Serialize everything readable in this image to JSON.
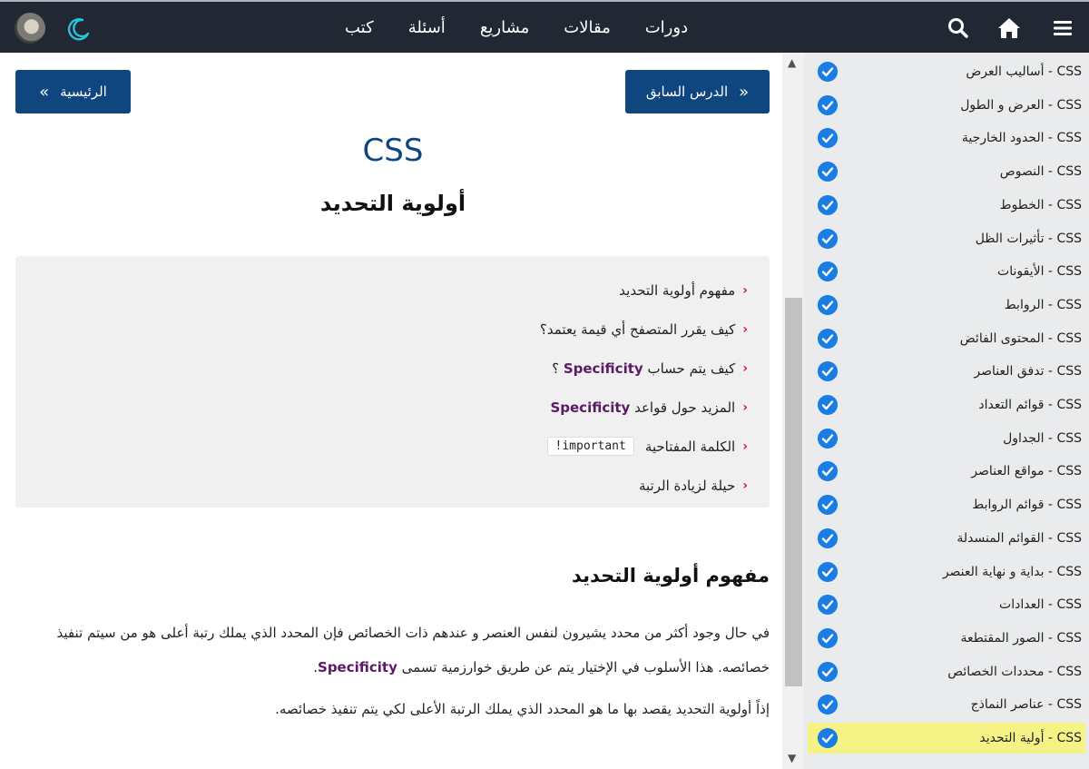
{
  "topbar": {
    "nav": [
      "دورات",
      "مقالات",
      "مشاريع",
      "أسئلة",
      "كتب"
    ]
  },
  "buttons": {
    "previous": "الدرس السابق",
    "home": "الرئيسية",
    "prev_chevron": "«",
    "home_chevron": "»"
  },
  "page": {
    "title": "CSS",
    "lesson_title": "أولوية التحديد"
  },
  "toc": [
    {
      "text": "مفهوم أولوية التحديد"
    },
    {
      "text": "كيف يقرر المتصفح أي قيمة يعتمد؟"
    },
    {
      "text": "كيف يتم حساب",
      "keyword": "Specificity",
      "after": " ؟"
    },
    {
      "text": "المزيد حول قواعد",
      "keyword": "Specificity"
    },
    {
      "text": "الكلمة المفتاحية",
      "code": "!important"
    },
    {
      "text": "حيلة لزيادة الرتبة"
    }
  ],
  "toc_arrow": "‹",
  "section": {
    "heading": "مفهوم أولوية التحديد",
    "p1": "في حال وجود أكثر من محدد يشيرون لنفس العنصر و عندهم ذات الخصائص فإن المحدد الذي يملك رتبة أعلى هو من سيتم تنفيذ",
    "p1b": "خصائصه. هذا الأسلوب في الإختيار يتم عن طريق خوارزمية تسمى",
    "p1_keyword": "Specificity",
    "p1_end": ".",
    "p2": "إذاً أولوية التحديد يقصد بها ما هو المحدد الذي يملك الرتبة الأعلى لكي يتم تنفيذ خصائصه."
  },
  "scrollbar": {
    "up": "▲",
    "down": "▼"
  },
  "sidebar": {
    "items": [
      "CSS - أساليب العرض",
      "CSS - العرض و الطول",
      "CSS - الحدود الخارجية",
      "CSS - النصوص",
      "CSS - الخطوط",
      "CSS - تأثيرات الظل",
      "CSS - الأيقونات",
      "CSS - الروابط",
      "CSS - المحتوى الفائض",
      "CSS - تدفق العناصر",
      "CSS - قوائم التعداد",
      "CSS - الجداول",
      "CSS - مواقع العناصر",
      "CSS - قوائم الروابط",
      "CSS - القوائم المنسدلة",
      "CSS - بداية و نهاية العنصر",
      "CSS - العدادات",
      "CSS - الصور المقتطعة",
      "CSS - محددات الخصائص",
      "CSS - عناصر النماذج",
      "CSS - أولية التحديد"
    ],
    "active_index": 20
  },
  "colors": {
    "topbar": "#212833",
    "primary": "#0f467f",
    "moon": "#27c3d9",
    "check": "#1a7de3",
    "active_highlight": "#f5f385",
    "keyword": "#5b1a66",
    "arrow": "#d11a2a"
  },
  "icons": {
    "moon": "moon-icon",
    "search": "search-icon",
    "home": "home-icon",
    "menu": "hamburger-menu-icon",
    "check": "check-circle-icon"
  }
}
